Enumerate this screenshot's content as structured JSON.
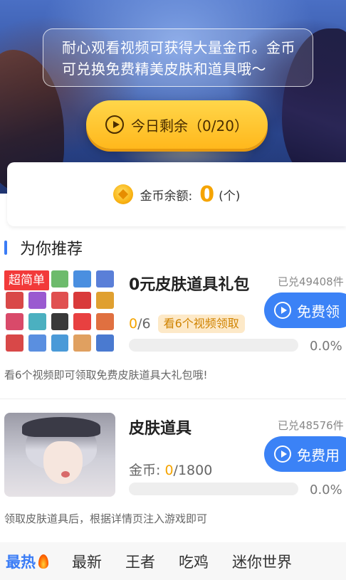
{
  "hero": {
    "notice": "耐心观看视频可获得大量金币。金币可兑换免费精美皮肤和道具哦～",
    "watch_button": "今日剩余（0/20）"
  },
  "balance": {
    "label": "金币余额:",
    "value": "0",
    "unit": "(个)"
  },
  "section": {
    "title": "为你推荐"
  },
  "items": [
    {
      "badge": "超简单",
      "title": "0元皮肤道具礼包",
      "redeemed": "已兑49408件",
      "button": "免费领",
      "progress_current": "0",
      "progress_total": "/6",
      "tag": "看6个视频领取",
      "progress_fraction": 0.0,
      "progress_percent": "0.0%",
      "description": "看6个视频即可领取免费皮肤道具大礼包哦!",
      "thumbnail_colors": [
        "#e95a5a",
        "#e96a7d",
        "#6dbb6c",
        "#4a8fe0",
        "#5a7fd8",
        "#d94848",
        "#9a5ad0",
        "#e05050",
        "#d93a3a",
        "#e0a030",
        "#d94a6a",
        "#4bb0c0",
        "#393939",
        "#e84040",
        "#e07040",
        "#d84848",
        "#5a8fe0",
        "#4a9ad8",
        "#e0a060",
        "#4a7ad0"
      ]
    },
    {
      "title": "皮肤道具",
      "redeemed": "已兑48576件",
      "button": "免费用",
      "coin_label": "金币: ",
      "coin_current": "0",
      "coin_total": "/1800",
      "progress_fraction": 0.0,
      "progress_percent": "0.0%",
      "description": "领取皮肤道具后，根据详情页注入游戏即可"
    }
  ],
  "tabs": [
    {
      "label": "最热",
      "active": true,
      "icon": "fire-icon"
    },
    {
      "label": "最新",
      "active": false
    },
    {
      "label": "王者",
      "active": false
    },
    {
      "label": "吃鸡",
      "active": false
    },
    {
      "label": "迷你世界",
      "active": false
    }
  ],
  "colors": {
    "accent_blue": "#3b82f6",
    "coin_orange": "#f5a400",
    "badge_red": "#f23a3a",
    "button_yellow": "#ffc42a"
  }
}
